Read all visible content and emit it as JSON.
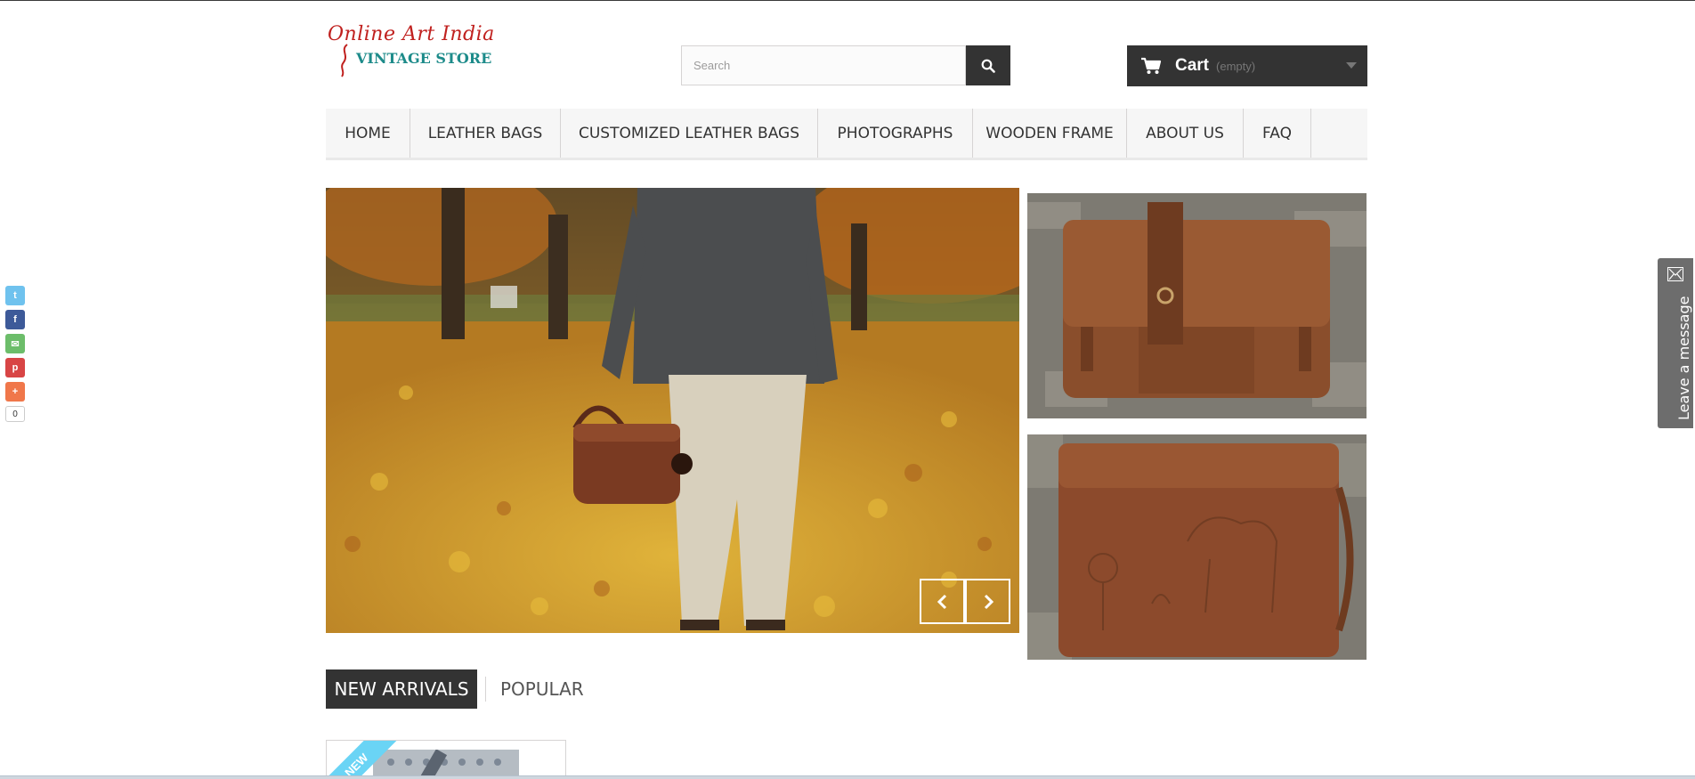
{
  "logo": {
    "line1": "Online Art India",
    "line2": "VINTAGE STORE"
  },
  "search": {
    "placeholder": "Search",
    "button_icon": "search-icon"
  },
  "cart": {
    "label": "Cart",
    "status": "(empty)",
    "icon": "cart-icon"
  },
  "menu": {
    "items": [
      {
        "label": "HOME"
      },
      {
        "label": "LEATHER BAGS"
      },
      {
        "label": "CUSTOMIZED LEATHER BAGS"
      },
      {
        "label": "PHOTOGRAPHS"
      },
      {
        "label": "WOODEN FRAME"
      },
      {
        "label": "ABOUT US"
      },
      {
        "label": "FAQ"
      }
    ]
  },
  "slider": {
    "prev_icon": "chevron-left-icon",
    "next_icon": "chevron-right-icon"
  },
  "tabs": {
    "active": "NEW ARRIVALS",
    "other": "POPULAR"
  },
  "product": {
    "badge": "NEW"
  },
  "social": {
    "buttons": [
      {
        "name": "twitter",
        "glyph": "t",
        "color": "#6fc2ee"
      },
      {
        "name": "facebook",
        "glyph": "f",
        "color": "#3d5a99"
      },
      {
        "name": "email",
        "glyph": "✉",
        "color": "#6cbd6a"
      },
      {
        "name": "pinterest",
        "glyph": "p",
        "color": "#d84545"
      },
      {
        "name": "more",
        "glyph": "+",
        "color": "#f0774a"
      }
    ],
    "count": "0"
  },
  "leave_message": {
    "label": "Leave a message"
  },
  "colors": {
    "dark": "#333333",
    "menu_bg": "#f6f6f6",
    "logo_red": "#c0211f",
    "logo_teal": "#1d8b8a",
    "ribbon": "#6ad4f5"
  }
}
